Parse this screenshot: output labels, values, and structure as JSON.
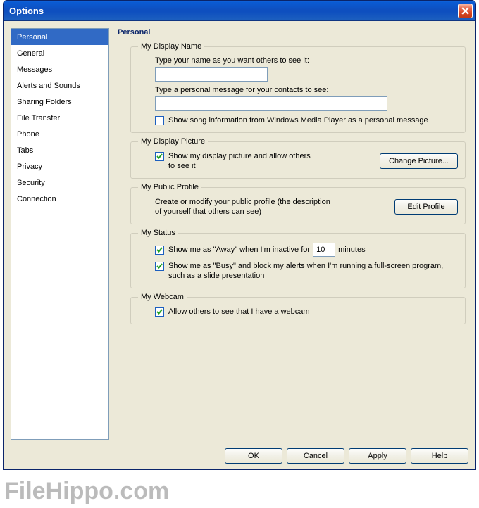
{
  "window": {
    "title": "Options"
  },
  "sidebar": {
    "items": [
      {
        "label": "Personal",
        "active": true
      },
      {
        "label": "General"
      },
      {
        "label": "Messages"
      },
      {
        "label": "Alerts and Sounds"
      },
      {
        "label": "Sharing Folders"
      },
      {
        "label": "File Transfer"
      },
      {
        "label": "Phone"
      },
      {
        "label": "Tabs"
      },
      {
        "label": "Privacy"
      },
      {
        "label": "Security"
      },
      {
        "label": "Connection"
      }
    ]
  },
  "panel": {
    "title": "Personal",
    "display_name": {
      "legend": "My Display Name",
      "name_prompt": "Type your name as you want others to see it:",
      "name_value": "",
      "pm_prompt": "Type a personal message for your contacts to see:",
      "pm_value": "",
      "song_cb_checked": false,
      "song_cb_label": "Show song information from Windows Media Player as a personal message"
    },
    "display_picture": {
      "legend": "My Display Picture",
      "show_cb_checked": true,
      "show_cb_label": "Show my display picture and allow others to see it",
      "change_button": "Change Picture..."
    },
    "public_profile": {
      "legend": "My Public Profile",
      "desc": "Create or modify your public profile (the description of yourself that others can see)",
      "edit_button": "Edit Profile"
    },
    "status": {
      "legend": "My Status",
      "away_cb_checked": true,
      "away_prefix": "Show me as \"Away\" when I'm inactive for",
      "away_minutes": "10",
      "away_suffix": "minutes",
      "busy_cb_checked": true,
      "busy_label": "Show me as \"Busy\" and block my alerts when I'm running a full-screen program, such as a slide presentation"
    },
    "webcam": {
      "legend": "My Webcam",
      "allow_cb_checked": true,
      "allow_cb_label": "Allow others to see that I have a webcam"
    }
  },
  "buttons": {
    "ok": "OK",
    "cancel": "Cancel",
    "apply": "Apply",
    "help": "Help"
  },
  "watermark": "FileHippo.com"
}
